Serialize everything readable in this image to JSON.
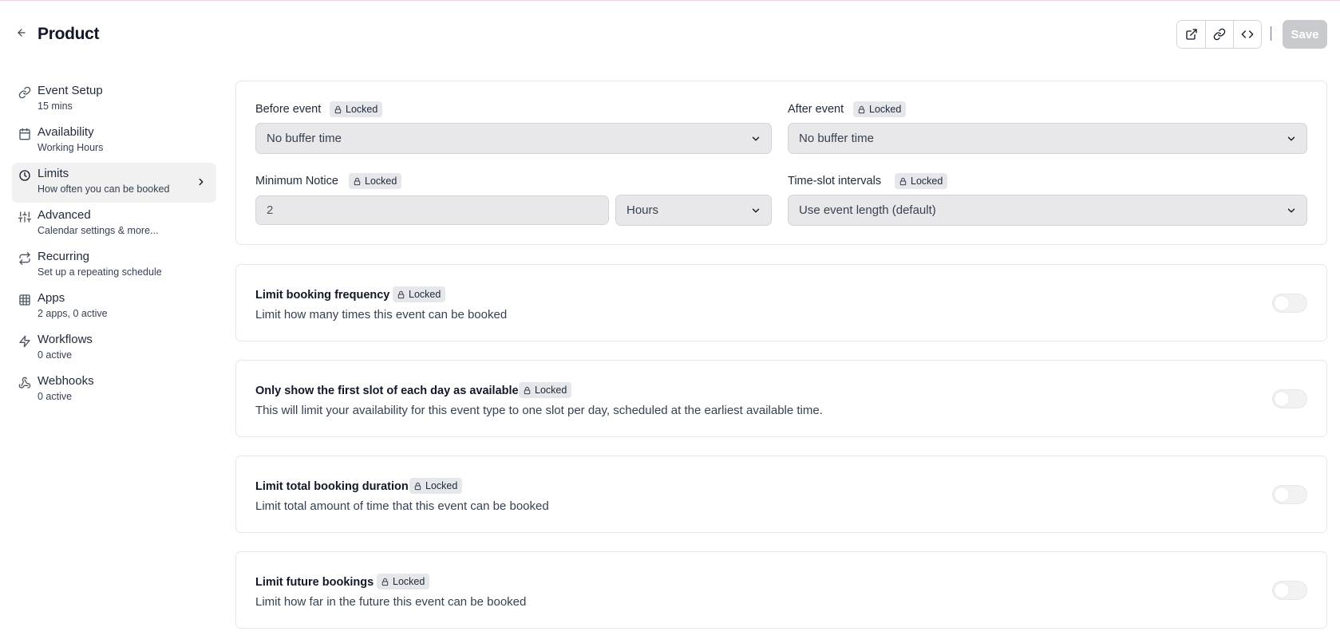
{
  "header": {
    "title": "Product",
    "back_icon": "arrow-left-icon",
    "actions": [
      {
        "icon": "external-link-icon"
      },
      {
        "icon": "link-icon"
      },
      {
        "icon": "code-icon"
      }
    ],
    "save_label": "Save"
  },
  "sidebar": {
    "items": [
      {
        "label": "Event Setup",
        "sub": "15 mins",
        "icon": "link-icon"
      },
      {
        "label": "Availability",
        "sub": "Working Hours",
        "icon": "calendar-icon"
      },
      {
        "label": "Limits",
        "sub": "How often you can be booked",
        "icon": "clock-icon",
        "active": true
      },
      {
        "label": "Advanced",
        "sub": "Calendar settings & more...",
        "icon": "sliders-icon"
      },
      {
        "label": "Recurring",
        "sub": "Set up a repeating schedule",
        "icon": "repeat-icon"
      },
      {
        "label": "Apps",
        "sub": "2 apps, 0 active",
        "icon": "grid-icon"
      },
      {
        "label": "Workflows",
        "sub": "0 active",
        "icon": "zap-icon"
      },
      {
        "label": "Webhooks",
        "sub": "0 active",
        "icon": "webhook-icon"
      }
    ]
  },
  "buffers": {
    "before_event": {
      "label": "Before event",
      "badge": "Locked",
      "value": "No buffer time"
    },
    "after_event": {
      "label": "After event",
      "badge": "Locked",
      "value": "No buffer time"
    },
    "minimum_notice": {
      "label": "Minimum Notice",
      "badge": "Locked",
      "value": "2",
      "unit": "Hours"
    },
    "time_slot_intervals": {
      "label": "Time-slot intervals",
      "badge": "Locked",
      "value": "Use event length (default)"
    }
  },
  "limits": [
    {
      "title": "Limit booking frequency",
      "badge": "Locked",
      "description": "Limit how many times this event can be booked",
      "enabled": false
    },
    {
      "title": "Only show the first slot of each day as available",
      "badge": "Locked",
      "description": "This will limit your availability for this event type to one slot per day, scheduled at the earliest available time.",
      "enabled": false
    },
    {
      "title": "Limit total booking duration",
      "badge": "Locked",
      "description": "Limit total amount of time that this event can be booked",
      "enabled": false
    },
    {
      "title": "Limit future bookings",
      "badge": "Locked",
      "description": "Limit how far in the future this event can be booked",
      "enabled": false
    }
  ],
  "colors": {
    "active_nav_bg": "#f1f1f2",
    "field_bg": "#e8e8ea",
    "badge_bg": "#e5e7eb",
    "save_disabled_bg": "#c9cacd"
  }
}
